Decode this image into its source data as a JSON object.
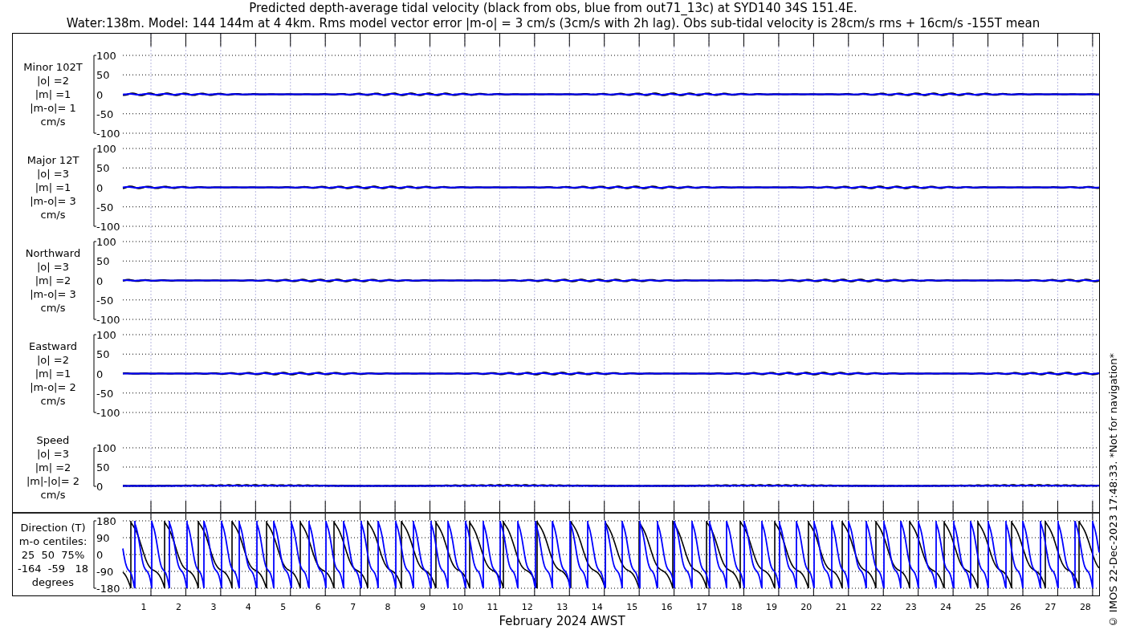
{
  "title": {
    "line_1": "Predicted depth-average tidal velocity (black from obs, blue from out71_13c) at SYD140 34S 151.4E.",
    "line_2": "Water:138m. Model: 144 144m at 4 4km. Rms model vector error |m-o| = 3 cm/s (3cm/s with 2h lag). Obs sub-tidal velocity is 28cm/s rms + 16cm/s -155T mean"
  },
  "panels": [
    {
      "kind": "velocity",
      "label": [
        "Minor 102T",
        "|o| =2",
        "|m| =1",
        "|m-o|= 1",
        "cm/s"
      ],
      "yticks": [
        "100",
        "50",
        "0",
        "-50",
        "-100"
      ]
    },
    {
      "kind": "velocity",
      "label": [
        "Major 12T",
        "|o| =3",
        "|m| =1",
        "|m-o|= 3",
        "cm/s"
      ],
      "yticks": [
        "100",
        "50",
        "0",
        "-50",
        "-100"
      ]
    },
    {
      "kind": "velocity",
      "label": [
        "Northward",
        "|o| =3",
        "|m| =2",
        "|m-o|= 3",
        "cm/s"
      ],
      "yticks": [
        "100",
        "50",
        "0",
        "-50",
        "-100"
      ]
    },
    {
      "kind": "velocity",
      "label": [
        "Eastward",
        "|o| =2",
        "|m| =1",
        "|m-o|= 2",
        "cm/s"
      ],
      "yticks": [
        "100",
        "50",
        "0",
        "-50",
        "-100"
      ]
    },
    {
      "kind": "speed",
      "label": [
        "Speed",
        "|o| =3",
        "|m| =2",
        "|m|-|o|= 2",
        "cm/s"
      ],
      "yticks": [
        "100",
        "50",
        "0"
      ]
    },
    {
      "kind": "direction",
      "label": [
        "Direction (T)",
        "m-o centiles:",
        "25  50  75%",
        "-164  -59   18",
        "degrees"
      ],
      "yticks": [
        "180",
        "90",
        "0",
        "-90",
        "-180"
      ]
    }
  ],
  "x_axis": {
    "ticks": [
      "1",
      "2",
      "3",
      "4",
      "5",
      "6",
      "7",
      "8",
      "9",
      "10",
      "11",
      "12",
      "13",
      "14",
      "15",
      "16",
      "17",
      "18",
      "19",
      "20",
      "21",
      "22",
      "23",
      "24",
      "25",
      "26",
      "27",
      "28"
    ],
    "label": "February 2024 AWST"
  },
  "credit": "© IMOS 22-Dec-2023 17:48:33. *Not for navigation*"
}
